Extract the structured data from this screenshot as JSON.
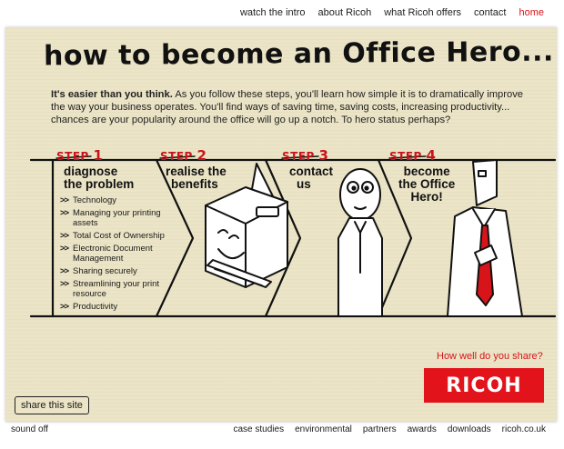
{
  "top_nav": [
    {
      "label": "watch the intro",
      "active": false
    },
    {
      "label": "about Ricoh",
      "active": false
    },
    {
      "label": "what Ricoh offers",
      "active": false
    },
    {
      "label": "contact",
      "active": false
    },
    {
      "label": "home",
      "active": true
    }
  ],
  "title": "how to become an Office Hero...",
  "intro": {
    "lead": "It's easier than you think.",
    "body": " As you follow these steps, you'll learn how simple it is to dramatically improve the way your business operates. You'll find ways of saving time, saving costs, increasing productivity... chances are your popularity around the office will go up a notch. To hero status perhaps?"
  },
  "steps": [
    {
      "label": "STEP",
      "num": "1",
      "heading_lines": [
        "diagnose",
        "the problem"
      ]
    },
    {
      "label": "STEP",
      "num": "2",
      "heading_lines": [
        "realise the",
        "benefits"
      ]
    },
    {
      "label": "STEP",
      "num": "3",
      "heading_lines": [
        "contact",
        "us"
      ]
    },
    {
      "label": "STEP",
      "num": "4",
      "heading_lines": [
        "become",
        "the Office",
        "Hero!"
      ]
    }
  ],
  "checklist": [
    "Technology",
    "Managing your printing assets",
    "Total Cost of Ownership",
    "Electronic Document Management",
    "Sharing securely",
    "Streamlining your print resource",
    "Productivity"
  ],
  "checklist_bullet": ">>",
  "share_question": "How well do you share?",
  "logo_text": "RICOH",
  "share_button": "share this site",
  "sound_toggle": "sound off",
  "footer_nav": [
    "case studies",
    "environmental",
    "partners",
    "awards",
    "downloads",
    "ricoh.co.uk"
  ],
  "colors": {
    "accent": "#d8141b",
    "paper": "#ebe4c6",
    "logo_bg": "#e3131b"
  }
}
